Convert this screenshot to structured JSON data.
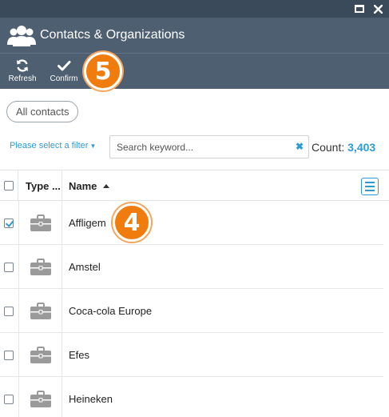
{
  "window": {
    "title": "Contatcs & Organizations"
  },
  "toolbar": {
    "refresh_label": "Refresh",
    "confirm_label": "Confirm"
  },
  "annotations": {
    "step_top": "5",
    "step_row": "4"
  },
  "filters": {
    "chip_label": "All contacts",
    "filter_link": "Please select a filter",
    "search_placeholder": "Search keyword...",
    "search_value": "",
    "count_label": "Count:",
    "count_value": "3,403"
  },
  "table": {
    "columns": {
      "type": "Type ...",
      "name": "Name"
    },
    "sort": "ascending",
    "rows": [
      {
        "name": "Affligem",
        "checked": true
      },
      {
        "name": "Amstel",
        "checked": false
      },
      {
        "name": "Coca-cola Europe",
        "checked": false
      },
      {
        "name": "Efes",
        "checked": false
      },
      {
        "name": "Heineken",
        "checked": false
      }
    ]
  },
  "colors": {
    "header_bg": "#4d5f71",
    "accent": "#2d9bd3",
    "badge": "#f07c0d"
  }
}
